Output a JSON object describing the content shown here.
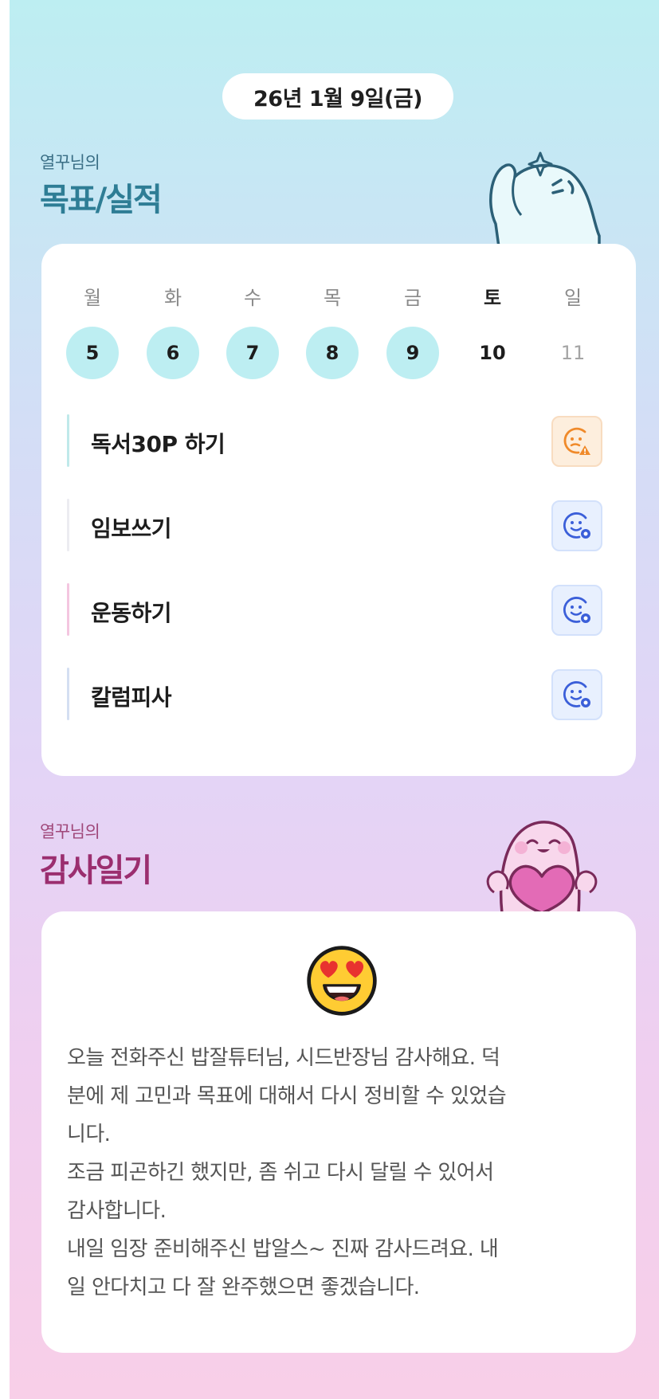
{
  "date_label": "26년 1월 9일(금)",
  "goals_section": {
    "subtitle": "열꾸님의",
    "title": "목표/실적",
    "weekdays": [
      "월",
      "화",
      "수",
      "목",
      "금",
      "토",
      "일"
    ],
    "dates": [
      "5",
      "6",
      "7",
      "8",
      "9",
      "10",
      "11"
    ],
    "date_states": [
      "done",
      "done",
      "done",
      "done",
      "done",
      "today",
      "future"
    ],
    "goals": [
      {
        "label": "독서30P 하기",
        "bar_color": "#bfe9ea",
        "status": "warn",
        "icon": "face-warning-icon"
      },
      {
        "label": "임보쓰기",
        "bar_color": "#ececf1",
        "status": "ok",
        "icon": "face-settings-icon"
      },
      {
        "label": "운동하기",
        "bar_color": "#f4c6e0",
        "status": "ok",
        "icon": "face-settings-icon"
      },
      {
        "label": "칼럼피사",
        "bar_color": "#d4dff2",
        "status": "ok",
        "icon": "face-settings-icon"
      }
    ]
  },
  "diary_section": {
    "subtitle": "열꾸님의",
    "title": "감사일기",
    "emoji": "heart-eyes-face-icon",
    "lines": [
      "오늘 전화주신 밥잘튜터님, 시드반장님 감사해요. 덕",
      "분에 제 고민과 목표에 대해서 다시 정비할 수 있었습",
      "니다.",
      "조금 피곤하긴 했지만, 좀 쉬고 다시 달릴 수 있어서",
      "감사합니다.",
      "내일 임장 준비해주신 밥알스~ 진짜 감사드려요. 내",
      "일 안다치고 다 잘 완주했으면 좋겠습니다."
    ]
  },
  "colors": {
    "goal_title": "#2e7d95",
    "diary_title": "#9b2e6f",
    "done_date": "#bdeef2",
    "warn_icon": "#f08a2a",
    "ok_icon": "#3b5fd9"
  }
}
